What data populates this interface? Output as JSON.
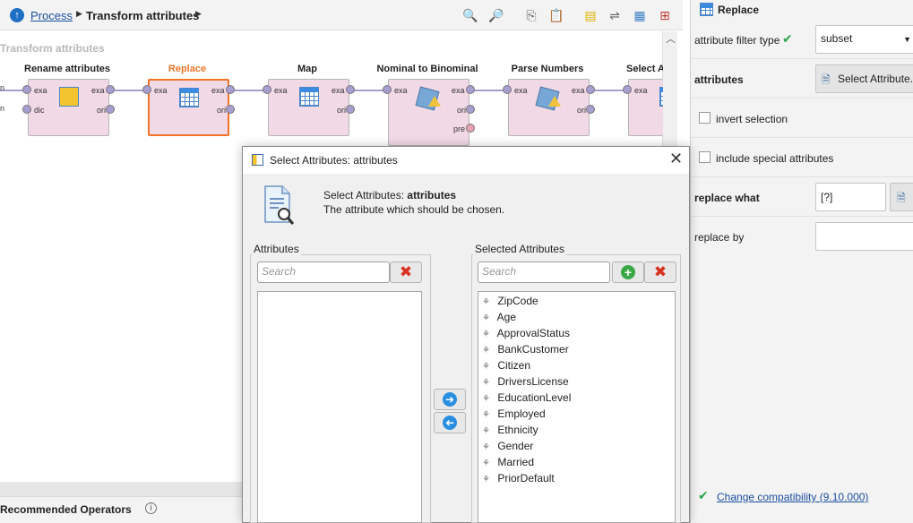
{
  "breadcrumb": {
    "process_link": "Process",
    "current": "Transform attributes"
  },
  "canvas": {
    "title": "Transform attributes",
    "operators": [
      {
        "name": "Rename attributes",
        "ports_in": [
          "exa",
          "dic"
        ],
        "ports_out": [
          "exa",
          "ori"
        ]
      },
      {
        "name": "Replace",
        "ports_in": [
          "exa"
        ],
        "ports_out": [
          "exa",
          "ori"
        ]
      },
      {
        "name": "Map",
        "ports_in": [
          "exa"
        ],
        "ports_out": [
          "exa",
          "ori"
        ]
      },
      {
        "name": "Nominal to Binominal",
        "ports_in": [
          "exa"
        ],
        "ports_out": [
          "exa",
          "ori",
          "pre"
        ]
      },
      {
        "name": "Parse Numbers",
        "ports_in": [
          "exa"
        ],
        "ports_out": [
          "exa",
          "ori"
        ]
      },
      {
        "name": "Select A",
        "ports_in": [
          "exa"
        ],
        "ports_out": []
      }
    ],
    "left_port_labels": [
      "n",
      "n"
    ]
  },
  "recommended": {
    "title": "Recommended Operators",
    "info_icon": "info-icon"
  },
  "params": {
    "operator_name": "Replace",
    "attribute_filter_type_label": "attribute filter type",
    "attribute_filter_type_value": "subset",
    "attributes_label": "attributes",
    "select_attributes_button": "Select Attribute...",
    "invert_selection_label": "invert selection",
    "include_special_label": "include special attributes",
    "replace_what_label": "replace what",
    "replace_what_value": "[?]",
    "replace_by_label": "replace by",
    "replace_by_value": "",
    "change_compat": "Change compatibility (9.10.000)"
  },
  "dialog": {
    "title": "Select Attributes: attributes",
    "heading_prefix": "Select Attributes: ",
    "heading_bold": "attributes",
    "description": "The attribute which should be chosen.",
    "left_group_label": "Attributes",
    "right_group_label": "Selected Attributes",
    "search_placeholder": "Search",
    "available_attributes": [],
    "selected_attributes": [
      "ZipCode",
      "Age",
      "ApprovalStatus",
      "BankCustomer",
      "Citizen",
      "DriversLicense",
      "EducationLevel",
      "Employed",
      "Ethnicity",
      "Gender",
      "Married",
      "PriorDefault"
    ]
  },
  "colors": {
    "accent_link": "#1a4fa0",
    "selected_operator_border": "#f0742b",
    "selected_operator_title": "#f0742b",
    "operator_fill": "#f2d9e6",
    "port_fill": "#a79ed0"
  }
}
